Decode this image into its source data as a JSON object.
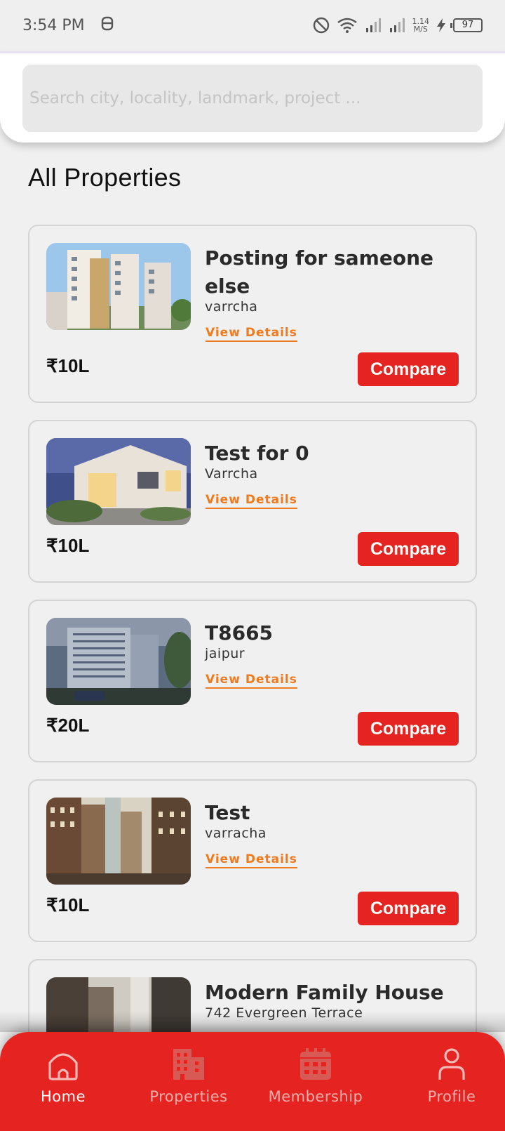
{
  "status_bar": {
    "time": "3:54 PM",
    "speed_value": "1.14",
    "speed_unit": "M/S",
    "battery": "97"
  },
  "search": {
    "placeholder": "Search city, locality, landmark, project ..."
  },
  "section": {
    "title": "All Properties"
  },
  "properties": [
    {
      "title": "Posting for sameone else",
      "location": "varrcha",
      "link": "View Details",
      "price": "₹10L",
      "button": "Compare"
    },
    {
      "title": "Test for 0",
      "location": "Varrcha",
      "link": "View Details",
      "price": "₹10L",
      "button": "Compare"
    },
    {
      "title": "T8665",
      "location": "jaipur",
      "link": "View Details",
      "price": "₹20L",
      "button": "Compare"
    },
    {
      "title": "Test",
      "location": "varracha",
      "link": "View Details",
      "price": "₹10L",
      "button": "Compare"
    },
    {
      "title": "Modern Family House",
      "location": "742 Evergreen Terrace"
    }
  ],
  "nav": {
    "items": [
      {
        "label": "Home",
        "icon": "home-icon",
        "active": true
      },
      {
        "label": "Properties",
        "icon": "building-icon",
        "active": false
      },
      {
        "label": "Membership",
        "icon": "calendar-icon",
        "active": false
      },
      {
        "label": "Profile",
        "icon": "person-icon",
        "active": false
      }
    ]
  },
  "colors": {
    "accent": "#e52320",
    "link": "#f07a1e",
    "background": "#f0f0f0"
  }
}
